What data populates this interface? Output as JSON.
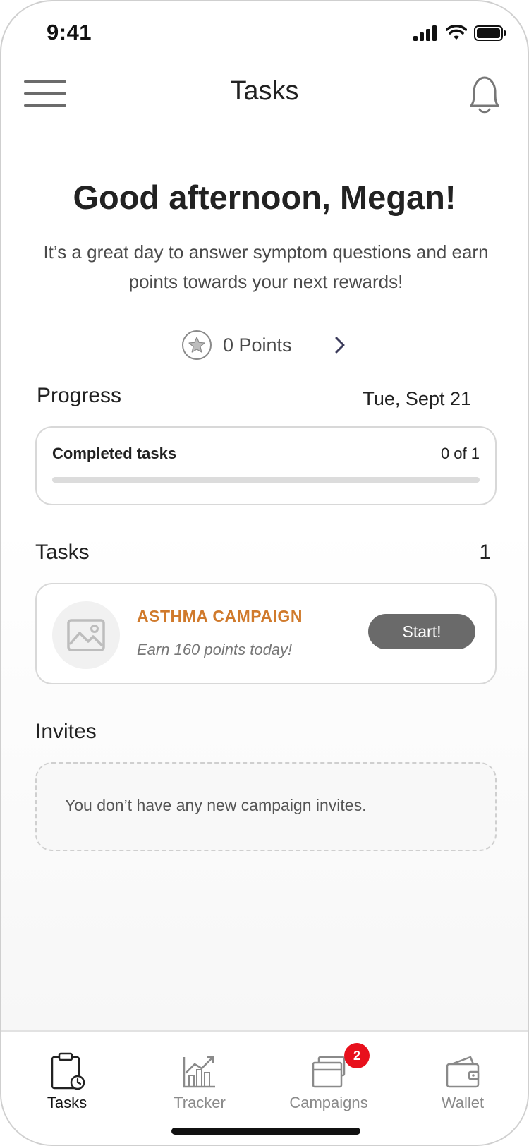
{
  "status_bar": {
    "time": "9:41"
  },
  "nav": {
    "title": "Tasks"
  },
  "greeting": "Good afternoon, Megan!",
  "subtext": "It’s a great day to answer symptom questions and earn points towards your next rewards!",
  "points": {
    "label": "0 Points",
    "value": 0
  },
  "progress": {
    "label": "Progress",
    "date": "Tue, Sept 21",
    "completed_label": "Completed tasks",
    "completed_value": "0 of 1",
    "fraction": 0
  },
  "tasks": {
    "label": "Tasks",
    "count": "1",
    "items": [
      {
        "title": "ASTHMA CAMPAIGN",
        "subtitle": "Earn 160 points today!",
        "button": "Start!"
      }
    ]
  },
  "invites": {
    "label": "Invites",
    "empty_text": "You don’t have any new campaign invites."
  },
  "tab_bar": {
    "tabs": [
      {
        "label": "Tasks",
        "icon": "clipboard-clock-icon",
        "active": true
      },
      {
        "label": "Tracker",
        "icon": "chart-icon",
        "active": false
      },
      {
        "label": "Campaigns",
        "icon": "stack-icon",
        "active": false,
        "badge": "2"
      },
      {
        "label": "Wallet",
        "icon": "wallet-icon",
        "active": false
      }
    ]
  },
  "colors": {
    "accent_orange": "#d07a2c",
    "badge_red": "#e8101c",
    "button_gray": "#6a6a6a"
  }
}
